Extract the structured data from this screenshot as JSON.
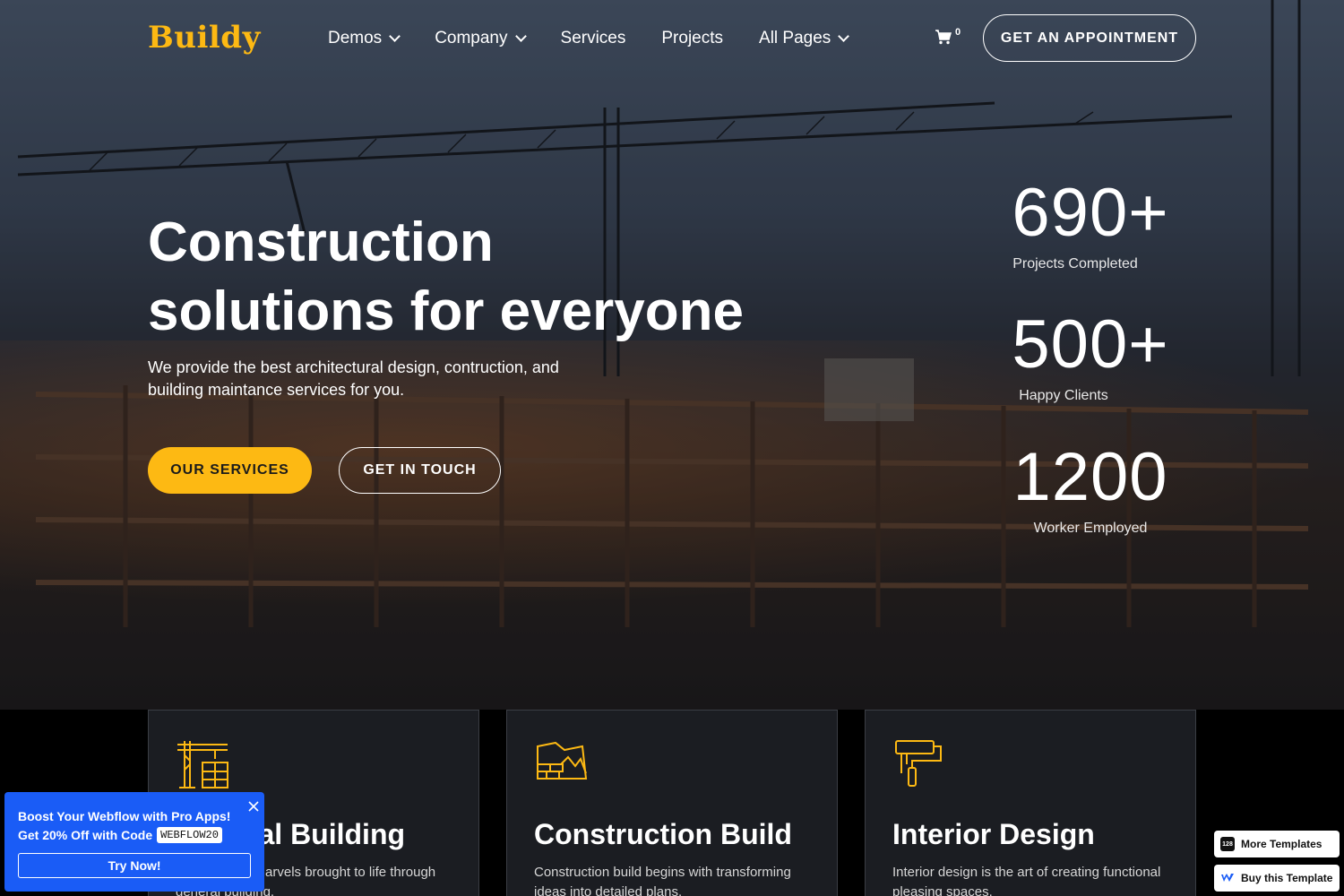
{
  "brand": {
    "logo": "Buildy",
    "accent": "#fdb913"
  },
  "nav": {
    "items": [
      {
        "label": "Demos",
        "dropdown": true
      },
      {
        "label": "Company",
        "dropdown": true
      },
      {
        "label": "Services",
        "dropdown": false
      },
      {
        "label": "Projects",
        "dropdown": false
      },
      {
        "label": "All Pages",
        "dropdown": true
      }
    ],
    "cart_count": "0",
    "cta_label": "GET AN APPOINTMENT"
  },
  "hero": {
    "title_line1": "Construction",
    "title_line2": "solutions for everyone",
    "subtitle": "We provide the best architectural design, contruction, and building maintance services for you.",
    "primary_button": "OUR SERVICES",
    "secondary_button": "GET IN TOUCH"
  },
  "stats": [
    {
      "value": "690+",
      "label": "Projects Completed"
    },
    {
      "value": "500+",
      "label": "Happy Clients"
    },
    {
      "value": "1200",
      "label": "Worker Employed"
    }
  ],
  "services": [
    {
      "title": "General Building",
      "description": "Architectural marvels brought to life through general building.",
      "icon": "crane-building-icon"
    },
    {
      "title": "Construction Build",
      "description": "Construction build begins with transforming ideas into detailed plans.",
      "icon": "blueprint-bricks-icon"
    },
    {
      "title": "Interior Design",
      "description": "Interior design is the art of creating functional pleasing spaces.",
      "icon": "paint-roller-icon"
    }
  ],
  "promo": {
    "line1": "Boost Your Webflow with Pro Apps!",
    "line2": "Get 20% Off with Code",
    "code": "WEBFLOW20",
    "button": "Try Now!",
    "color": "#1a5cf6"
  },
  "badges": {
    "more_templates": "More Templates",
    "more_templates_icon_text": "128",
    "buy_template": "Buy this Template"
  }
}
